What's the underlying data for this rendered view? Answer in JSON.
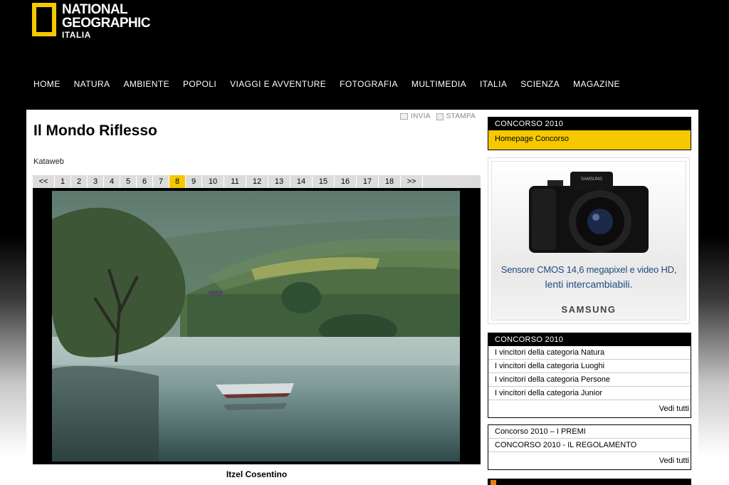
{
  "logo": {
    "line1": "NATIONAL",
    "line2": "GEOGRAPHIC",
    "line3": "ITALIA"
  },
  "nav": [
    "HOME",
    "NATURA",
    "AMBIENTE",
    "POPOLI",
    "VIAGGI E AVVENTURE",
    "FOTOGRAFIA",
    "MULTIMEDIA",
    "ITALIA",
    "SCIENZA",
    "MAGAZINE"
  ],
  "tools": {
    "send": "INVIA",
    "print": "STAMPA"
  },
  "article": {
    "title": "Il Mondo Riflesso",
    "source": "Kataweb",
    "caption": "Itzel Cosentino"
  },
  "pager": {
    "prev": "<<",
    "next": ">>",
    "pages": [
      "1",
      "2",
      "3",
      "4",
      "5",
      "6",
      "7",
      "8",
      "9",
      "10",
      "11",
      "12",
      "13",
      "14",
      "15",
      "16",
      "17",
      "18"
    ],
    "active": "8"
  },
  "sidebar": {
    "box1": {
      "head": "CONCORSO 2010",
      "link": "Homepage Concorso"
    },
    "ad": {
      "line1": "Sensore CMOS 14,6 megapixel e video HD,",
      "line2": "lenti intercambiabili.",
      "brand": "SAMSUNG",
      "camera_brand": "SAMSUNG"
    },
    "box2": {
      "head": "CONCORSO 2010",
      "items": [
        "I vincitori della categoria Natura",
        "I vincitori della categoria Luoghi",
        "I vincitori della categoria Persone",
        "I vincitori della categoria Junior"
      ],
      "more": "Vedi tutti"
    },
    "box3": {
      "items": [
        "Concorso 2010 – I PREMI",
        "CONCORSO 2010 - IL REGOLAMENTO"
      ],
      "more": "Vedi tutti"
    }
  },
  "colors": {
    "accent": "#f6c800",
    "header_bg": "#000000"
  }
}
